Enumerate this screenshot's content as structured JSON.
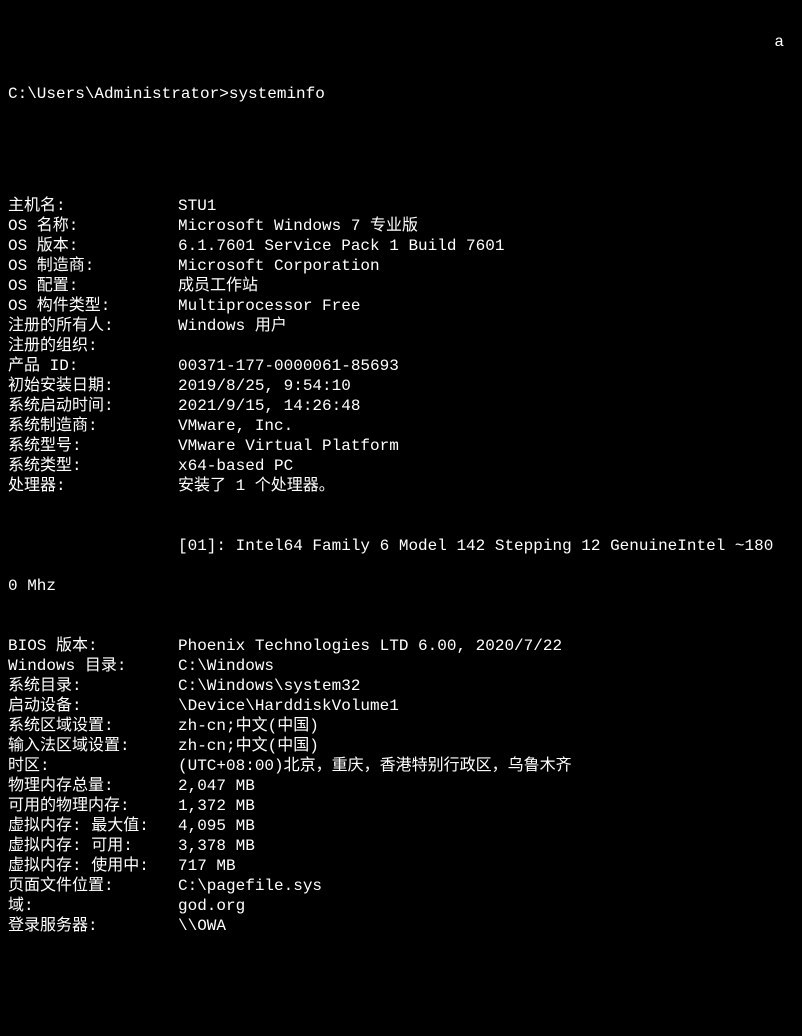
{
  "prompt": "C:\\Users\\Administrator>systeminfo",
  "floating_char": "a",
  "rows": [
    {
      "label": "主机名:",
      "value": "STU1"
    },
    {
      "label": "OS 名称:",
      "value": "Microsoft Windows 7 专业版"
    },
    {
      "label": "OS 版本:",
      "value": "6.1.7601 Service Pack 1 Build 7601"
    },
    {
      "label": "OS 制造商:",
      "value": "Microsoft Corporation"
    },
    {
      "label": "OS 配置:",
      "value": "成员工作站"
    },
    {
      "label": "OS 构件类型:",
      "value": "Multiprocessor Free"
    },
    {
      "label": "注册的所有人:",
      "value": "Windows 用户"
    },
    {
      "label": "注册的组织:",
      "value": ""
    },
    {
      "label": "产品 ID:",
      "value": "00371-177-0000061-85693"
    },
    {
      "label": "初始安装日期:",
      "value": "2019/8/25, 9:54:10"
    },
    {
      "label": "系统启动时间:",
      "value": "2021/9/15, 14:26:48"
    },
    {
      "label": "系统制造商:",
      "value": "VMware, Inc."
    },
    {
      "label": "系统型号:",
      "value": "VMware Virtual Platform"
    },
    {
      "label": "系统类型:",
      "value": "x64-based PC"
    },
    {
      "label": "处理器:",
      "value": "安装了 1 个处理器。"
    }
  ],
  "proc_line": "[01]: Intel64 Family 6 Model 142 Stepping 12 GenuineIntel ~180",
  "wrap_line": "0 Mhz",
  "rows2": [
    {
      "label": "BIOS 版本:",
      "value": "Phoenix Technologies LTD 6.00, 2020/7/22"
    },
    {
      "label": "Windows 目录:",
      "value": "C:\\Windows"
    },
    {
      "label": "系统目录:",
      "value": "C:\\Windows\\system32"
    },
    {
      "label": "启动设备:",
      "value": "\\Device\\HarddiskVolume1"
    },
    {
      "label": "系统区域设置:",
      "value": "zh-cn;中文(中国)"
    },
    {
      "label": "输入法区域设置:",
      "value": "zh-cn;中文(中国)"
    },
    {
      "label": "时区:",
      "value": "(UTC+08:00)北京，重庆，香港特别行政区，乌鲁木齐"
    },
    {
      "label": "物理内存总量:",
      "value": "2,047 MB"
    },
    {
      "label": "可用的物理内存:",
      "value": "1,372 MB"
    },
    {
      "label": "虚拟内存: 最大值:",
      "value": "4,095 MB"
    },
    {
      "label": "虚拟内存: 可用:",
      "value": "3,378 MB"
    },
    {
      "label": "虚拟内存: 使用中:",
      "value": "717 MB"
    },
    {
      "label": "页面文件位置:",
      "value": "C:\\pagefile.sys"
    },
    {
      "label": "域:",
      "value": "god.org"
    },
    {
      "label": "登录服务器:",
      "value": "\\\\OWA"
    }
  ]
}
